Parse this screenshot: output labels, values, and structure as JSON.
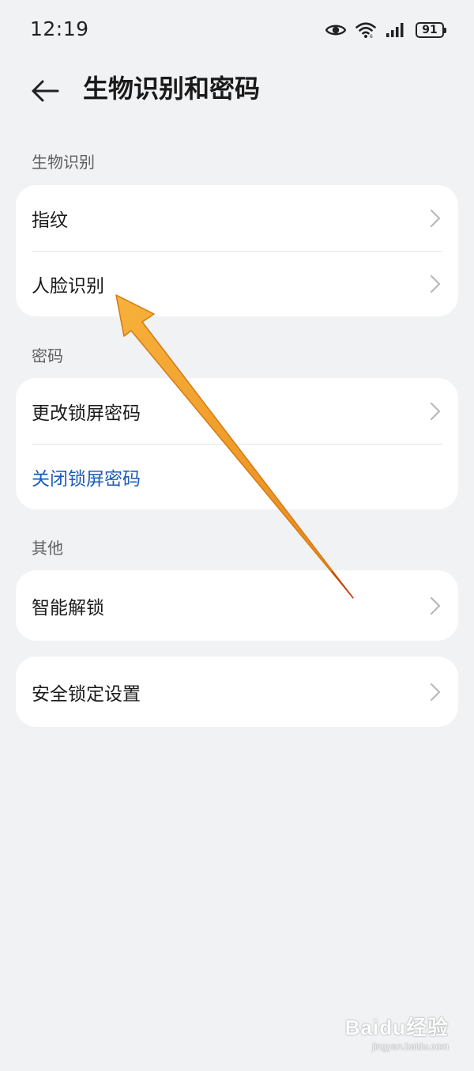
{
  "status_bar": {
    "time": "12:19",
    "battery": "91",
    "icons": [
      "eye-comfort-icon",
      "wifi-icon",
      "signal-icon",
      "battery-icon"
    ]
  },
  "header": {
    "title": "生物识别和密码",
    "back_icon": "arrow-left-icon"
  },
  "sections": {
    "biometrics": {
      "label": "生物识别",
      "items": [
        {
          "label": "指纹"
        },
        {
          "label": "人脸识别"
        }
      ]
    },
    "password": {
      "label": "密码",
      "items": [
        {
          "label": "更改锁屏密码"
        },
        {
          "label": "关闭锁屏密码"
        }
      ]
    },
    "other": {
      "label": "其他",
      "items": [
        {
          "label": "智能解锁"
        }
      ]
    },
    "security": {
      "items": [
        {
          "label": "安全锁定设置"
        }
      ]
    }
  },
  "annotation": {
    "color": "#f5a623",
    "target": "人脸识别"
  },
  "watermark": {
    "brand": "Baidu经验",
    "url": "jingyan.baidu.com"
  },
  "colors": {
    "background": "#f1f2f4",
    "card": "#ffffff",
    "link": "#1d5cb8",
    "arrow": "#f5a623"
  }
}
